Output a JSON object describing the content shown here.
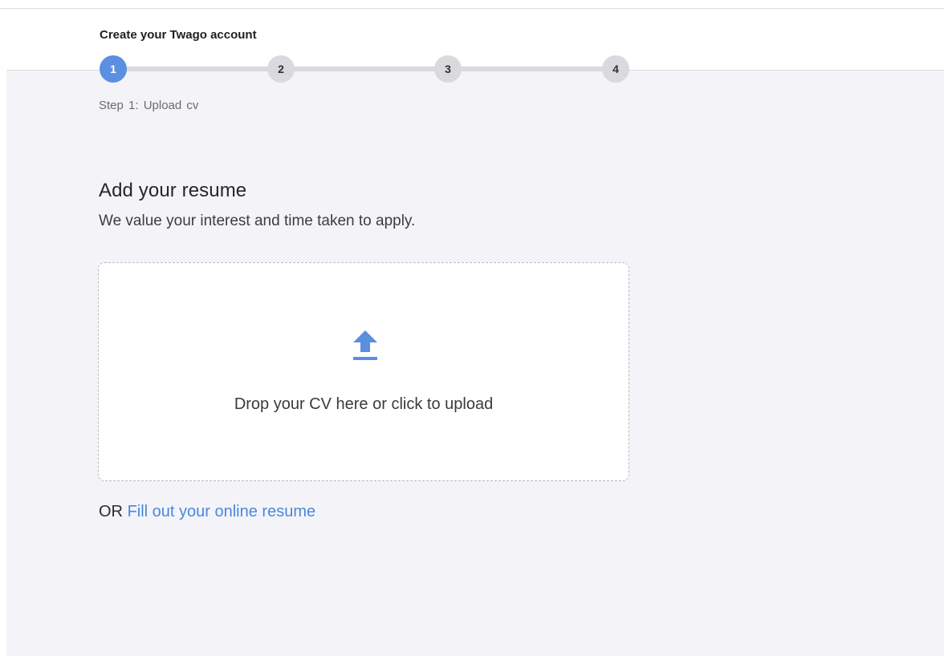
{
  "header": {
    "title": "Create your Twago account"
  },
  "stepper": {
    "steps": [
      "1",
      "2",
      "3",
      "4"
    ],
    "active_step": 1,
    "caption": "Step  1:  Upload cv"
  },
  "main": {
    "title": "Add your resume",
    "subtitle": "We value your interest and time taken to apply.",
    "dropzone": {
      "icon": "upload-icon",
      "text": "Drop your CV here or click to upload"
    },
    "alternative": {
      "prefix": "OR",
      "link_label": "Fill out your online resume"
    }
  },
  "colors": {
    "accent": "#5b8fe2",
    "link": "#4a88dc",
    "inactive_step": "#d9d9de",
    "content_background": "#f4f4f8"
  }
}
